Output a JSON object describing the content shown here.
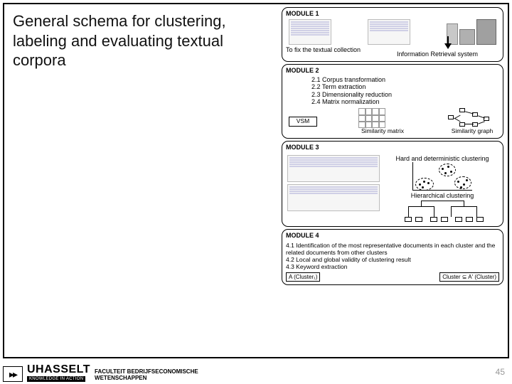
{
  "title": "General schema for clustering, labeling and evaluating textual corpora",
  "modules": {
    "m1": {
      "title": "MODULE 1",
      "left_text": "To fix the textual collection",
      "right_text": "Information Retrieval system"
    },
    "m2": {
      "title": "MODULE 2",
      "items": [
        "2.1 Corpus transformation",
        "2.2 Term extraction",
        "2.3 Dimensionality reduction",
        "2.4 Matrix normalization"
      ],
      "vsm": "VSM",
      "sim_matrix": "Similarity matrix",
      "sim_graph": "Similarity graph"
    },
    "m3": {
      "title": "MODULE 3",
      "hard_label": "Hard and deterministic clustering",
      "hier_label": "Hierarchical clustering"
    },
    "m4": {
      "title": "MODULE 4",
      "items": [
        "4.1 Identification of the most representative documents in each cluster and the related documents from other clusters",
        "4.2 Local and global validity of clustering result",
        "4.3 Keyword extraction"
      ],
      "a_cluster": "A (Cluster₁)",
      "a_all": "Cluster ⊆ A' (Cluster)"
    }
  },
  "footer": {
    "skip_glyph": "▸▸",
    "uhasselt": "UHASSELT",
    "kia": "KNOWLEDGE IN ACTION",
    "faculty1": "FACULTEIT BEDRIJFSECONOMISCHE",
    "faculty2": "WETENSCHAPPEN"
  },
  "page_number": "45"
}
